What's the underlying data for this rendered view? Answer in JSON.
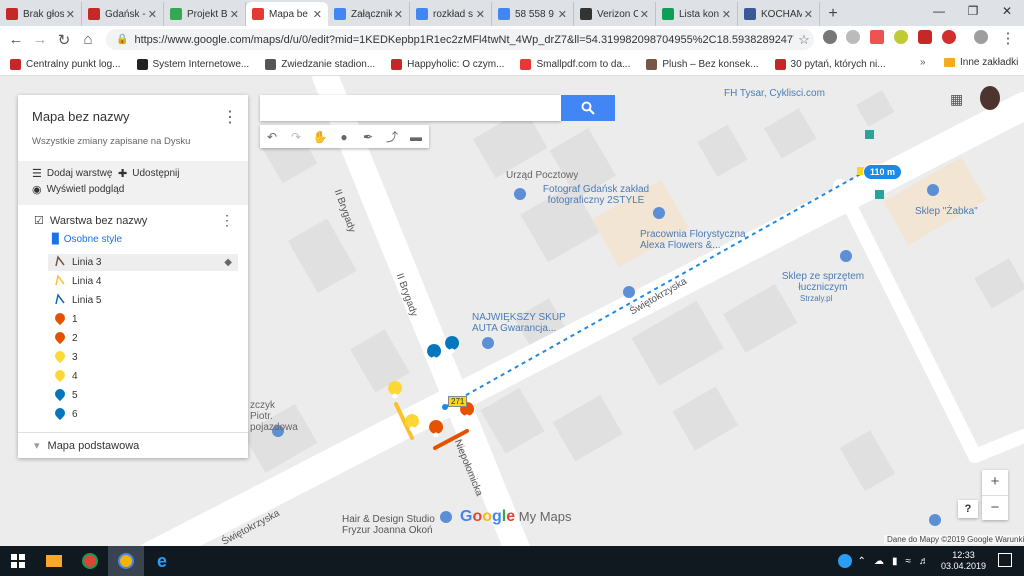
{
  "tabs": [
    {
      "label": "Brak głos",
      "color": "#c62828"
    },
    {
      "label": "Gdańsk -",
      "color": "#c62828"
    },
    {
      "label": "Projekt B",
      "color": "#34a853"
    },
    {
      "label": "Mapa be",
      "color": "#e53935",
      "active": true
    },
    {
      "label": "Załącznik",
      "color": "#4285f4"
    },
    {
      "label": "rozkład s",
      "color": "#4285f4"
    },
    {
      "label": "58 558 9",
      "color": "#4285f4"
    },
    {
      "label": "Verizon C",
      "color": "#333333"
    },
    {
      "label": "Lista kon",
      "color": "#0f9d58"
    },
    {
      "label": "KOCHAM",
      "color": "#3b5998"
    }
  ],
  "browser": {
    "url": "https://www.google.com/maps/d/u/0/edit?mid=1KEDKepbp1R1ec2zMFl4twNt_4Wp_drZ7&ll=54.319982098704955%2C18.5938289247787..."
  },
  "bookmarks": [
    {
      "label": "Centralny punkt log...",
      "color": "#c62828"
    },
    {
      "label": "System Internetowe...",
      "color": "#222222"
    },
    {
      "label": "Zwiedzanie stadion...",
      "color": "#555555"
    },
    {
      "label": "Happyholic: O czym...",
      "color": "#c62828"
    },
    {
      "label": "Smallpdf.com to da...",
      "color": "#e53935"
    },
    {
      "label": "Plush – Bez konsek...",
      "color": "#795548"
    },
    {
      "label": "30 pytań, których ni...",
      "color": "#c62828"
    }
  ],
  "bookmarks_more": "»",
  "bookmarks_other": "Inne zakładki",
  "panel": {
    "title": "Mapa bez nazwy",
    "subtitle": "Wszystkie zmiany zapisane na Dysku",
    "add_layer": "Dodaj warstwę",
    "share": "Udostępnij",
    "preview": "Wyświetl podgląd",
    "layer_name": "Warstwa bez nazwy",
    "layer_style": "Osobne style",
    "items": [
      {
        "label": "Linia 3",
        "kind": "line",
        "color": "#795548"
      },
      {
        "label": "Linia 4",
        "kind": "line",
        "color": "#fbc02d"
      },
      {
        "label": "Linia 5",
        "kind": "line",
        "color": "#1565c0"
      },
      {
        "label": "1",
        "kind": "pin",
        "color": "#e65100"
      },
      {
        "label": "2",
        "kind": "pin",
        "color": "#e65100"
      },
      {
        "label": "3",
        "kind": "pin",
        "color": "#fdd835"
      },
      {
        "label": "4",
        "kind": "pin",
        "color": "#fdd835"
      },
      {
        "label": "5",
        "kind": "pin",
        "color": "#0277bd"
      },
      {
        "label": "6",
        "kind": "pin",
        "color": "#0277bd"
      }
    ],
    "base_map": "Mapa podstawowa"
  },
  "map": {
    "search_placeholder": "",
    "distance": "110 m",
    "road_label": "271",
    "streets": [
      "II Brygady",
      "II Brygady",
      "Świętokrzyska",
      "Świętokrzyska",
      "Niepołomicka"
    ],
    "pois": [
      "FH Tysar, Cyklisci.com",
      "Urząd Pocztowy",
      "Fotograf Gdańsk zakład fotograficzny 2STYLE",
      "Pracownia Florystyczna Alexa Flowers &...",
      "Sklep \"Żabka\"",
      "Sklep ze sprzętem łuczniczym",
      "Strzaly.pl",
      "NAJWIĘKSZY SKUP AUTA Gwarancja...",
      "zczyk Piotr. pojazdowa",
      "Hair & Design Studio Fryzur Joanna Okoń",
      "IK Studio"
    ],
    "logo": "Google My Maps",
    "attribution": "Dane do Mapy ©2019 Google   Warunki",
    "zoom_in": "+",
    "zoom_out": "−",
    "help": "?"
  },
  "taskbar": {
    "time": "12:33",
    "date": "03.04.2019"
  }
}
